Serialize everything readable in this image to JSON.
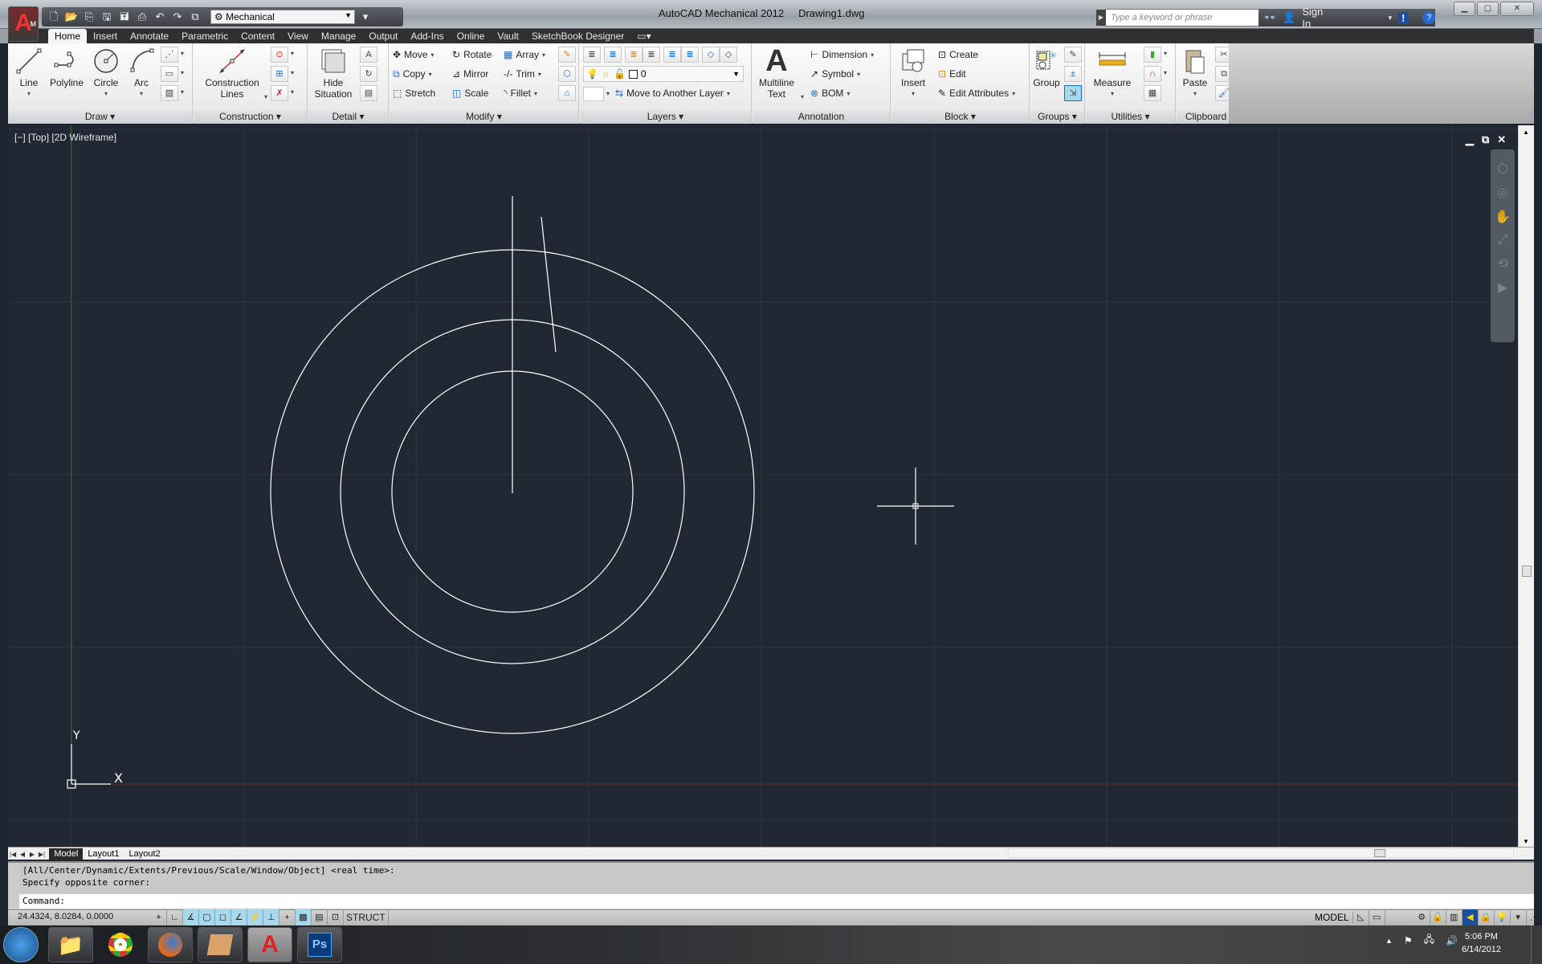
{
  "app": {
    "name": "AutoCAD Mechanical 2012",
    "document": "Drawing1.dwg",
    "logo_letter": "A",
    "logo_badge": "M"
  },
  "quick_access": {
    "icons": [
      "new-icon",
      "open-icon",
      "save-to-vault-icon",
      "save-icon",
      "save-as-icon",
      "plot-icon",
      "undo-icon",
      "redo-icon",
      "workspace-switch-icon"
    ],
    "workspace": "Mechanical"
  },
  "search": {
    "placeholder": "Type a keyword or phrase"
  },
  "infocenter": {
    "sign_in": "Sign In"
  },
  "ribbon_tabs": [
    "Home",
    "Insert",
    "Annotate",
    "Parametric",
    "Content",
    "View",
    "Manage",
    "Output",
    "Add-Ins",
    "Online",
    "Vault",
    "SketchBook Designer"
  ],
  "active_tab": "Home",
  "panels": {
    "draw": {
      "label": "Draw",
      "buttons": [
        "Line",
        "Polyline",
        "Circle",
        "Arc"
      ]
    },
    "construction": {
      "label": "Construction",
      "button_line1": "Construction",
      "button_line2": "Lines"
    },
    "detail": {
      "label": "Detail",
      "button_line1": "Hide",
      "button_line2": "Situation"
    },
    "modify": {
      "label": "Modify",
      "items": [
        "Move",
        "Rotate",
        "Array",
        "Copy",
        "Mirror",
        "Trim",
        "Stretch",
        "Scale",
        "Fillet"
      ]
    },
    "layers": {
      "label": "Layers",
      "current_layer": "0",
      "move_layer": "Move to Another Layer"
    },
    "annotation": {
      "label": "Annotation",
      "multiline_line1": "Multiline",
      "multiline_line2": "Text",
      "items": [
        "Dimension",
        "Symbol",
        "BOM"
      ]
    },
    "block": {
      "label": "Block",
      "insert": "Insert",
      "items": [
        "Create",
        "Edit",
        "Edit Attributes"
      ]
    },
    "groups": {
      "label": "Groups",
      "group": "Group"
    },
    "utilities": {
      "label": "Utilities",
      "measure": "Measure"
    },
    "clipboard": {
      "label": "Clipboard",
      "paste": "Paste"
    }
  },
  "viewport": {
    "label": "[−] [Top] [2D Wireframe]",
    "ucs_x": "X",
    "ucs_y": "Y"
  },
  "layout_tabs": [
    "Model",
    "Layout1",
    "Layout2"
  ],
  "active_layout": "Model",
  "command": {
    "history": [
      "[All/Center/Dynamic/Extents/Previous/Scale/Window/Object] <real time>:",
      "Specify opposite corner:"
    ],
    "prompt": "Command:"
  },
  "status": {
    "coords": "24.4324, 8.0284, 0.0000",
    "struct": "STRUCT",
    "model": "MODEL"
  },
  "taskbar": {
    "apps": [
      "Windows Explorer",
      "Google Chrome",
      "Firefox",
      "Sketchbook",
      "AutoCAD Mechanical",
      "Photoshop"
    ],
    "time": "5:06 PM",
    "date": "6/14/2012"
  }
}
